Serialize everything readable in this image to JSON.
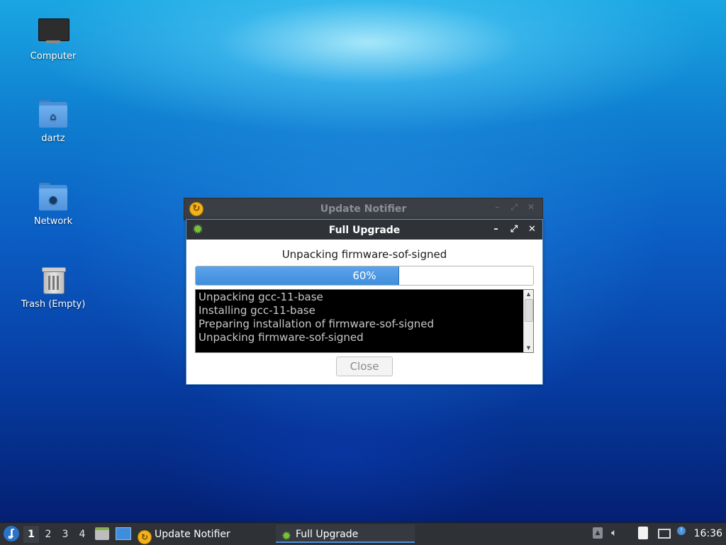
{
  "desktop": {
    "icons": [
      {
        "label": "Computer",
        "icon": "computer-icon"
      },
      {
        "label": "dartz",
        "icon": "home-folder-icon"
      },
      {
        "label": "Network",
        "icon": "network-folder-icon"
      },
      {
        "label": "Trash (Empty)",
        "icon": "trash-icon"
      }
    ]
  },
  "back_window": {
    "title": "Update Notifier",
    "icon": "update-notifier-icon",
    "controls": {
      "minimize": "–",
      "maximize": "⤢",
      "close": "✕"
    }
  },
  "dialog": {
    "title": "Full Upgrade",
    "icon": "gear-icon",
    "controls": {
      "minimize": "–",
      "maximize": "⤢",
      "close": "✕"
    },
    "status": "Unpacking firmware-sof-signed",
    "progress": {
      "percent": 60,
      "label": "60%"
    },
    "log_lines": [
      "Unpacking gcc-11-base",
      "Installing gcc-11-base",
      "Preparing installation of firmware-sof-signed",
      "Unpacking firmware-sof-signed"
    ],
    "close_label": "Close",
    "close_enabled": false
  },
  "taskbar": {
    "start_icon": "lxqt-menu-icon",
    "workspaces": [
      "1",
      "2",
      "3",
      "4"
    ],
    "active_workspace": "1",
    "quicklaunch": [
      "file-manager-icon",
      "show-desktop-icon"
    ],
    "tasks": [
      {
        "label": "Update Notifier",
        "icon": "update-notifier-icon",
        "active": false
      },
      {
        "label": "Full Upgrade",
        "icon": "gear-icon",
        "active": true
      }
    ],
    "tray": [
      "eject-icon",
      "volume-icon",
      "clipboard-icon",
      "network-icon",
      "notification-icon"
    ],
    "clock": "16:36"
  },
  "colors": {
    "accent": "#4a90d9",
    "progress_fill": "#3f8ddc",
    "taskbar_bg": "#2e3136",
    "titlebar_bg": "#2f3338"
  }
}
